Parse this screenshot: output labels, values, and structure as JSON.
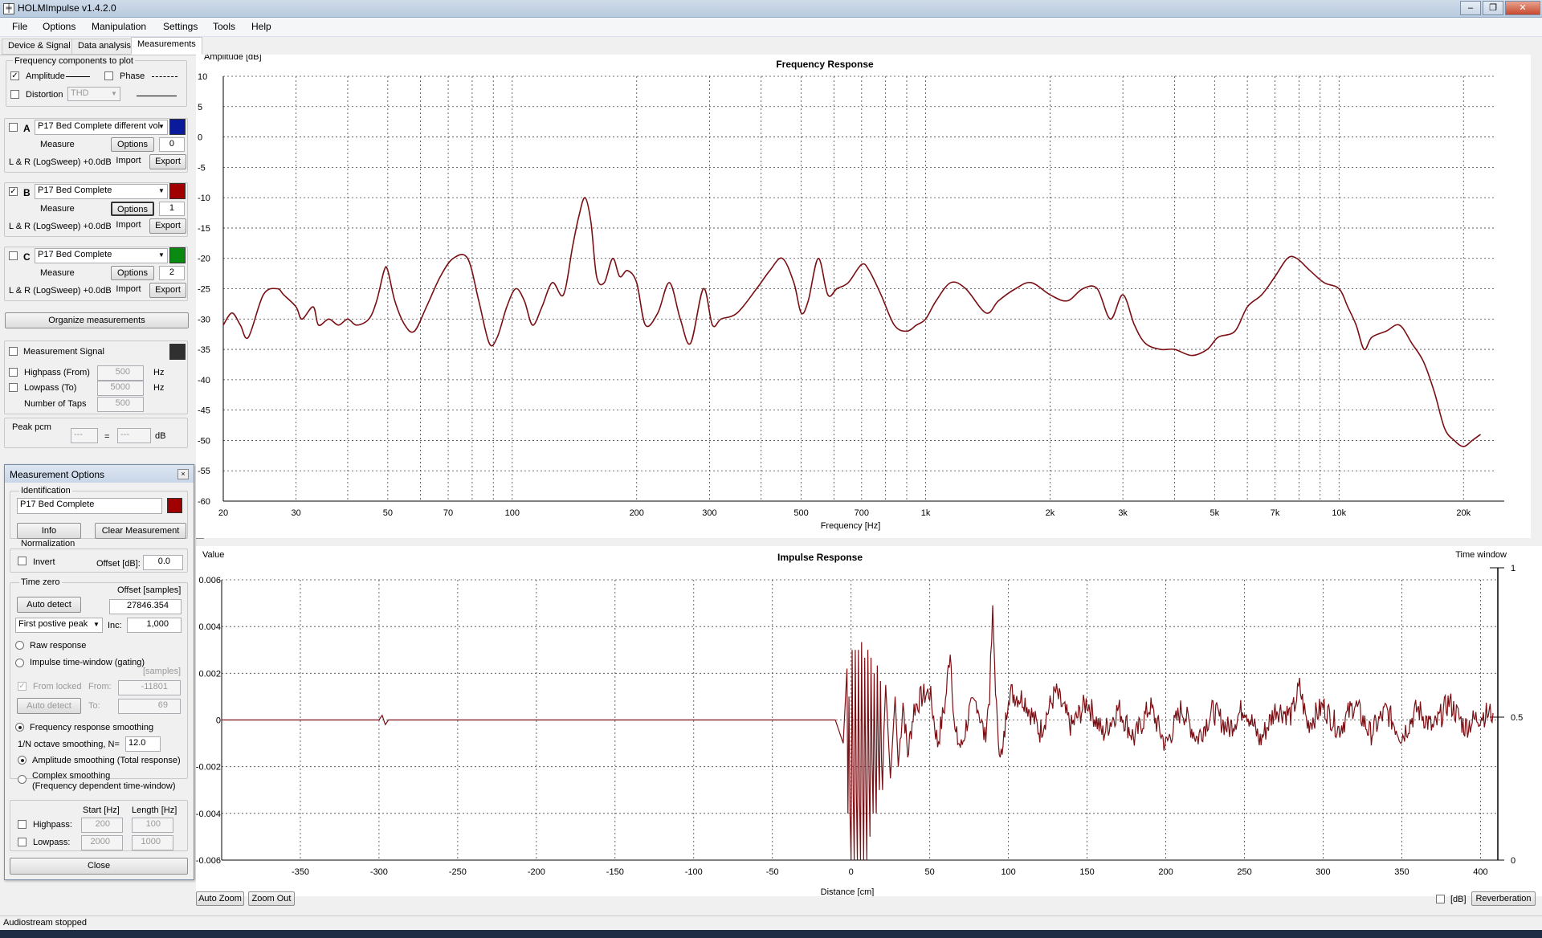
{
  "app": {
    "title": "HOLMImpulse  v1.4.2.0"
  },
  "menu": [
    "File",
    "Options",
    "Manipulation",
    "Settings",
    "Tools",
    "Help"
  ],
  "tabs": [
    "Device & Signal",
    "Data analysis",
    "Measurements"
  ],
  "freqcomp": {
    "title": "Frequency components to plot",
    "amplitude": "Amplitude",
    "phase": "Phase",
    "distortion": "Distortion",
    "distortion_select": "THD"
  },
  "slots": [
    {
      "letter": "A",
      "name": "P17 Bed Complete different vol",
      "color": "#0a1a9a",
      "checked": false,
      "index": "0",
      "info": "L & R (LogSweep) +0.0dB"
    },
    {
      "letter": "B",
      "name": "P17 Bed Complete",
      "color": "#a00000",
      "checked": true,
      "index": "1",
      "info": "L & R (LogSweep) +0.0dB"
    },
    {
      "letter": "C",
      "name": "P17 Bed Complete",
      "color": "#0a8a10",
      "checked": false,
      "index": "2",
      "info": "L & R (LogSweep) +0.0dB"
    }
  ],
  "slot_buttons": {
    "measure": "Measure",
    "options": "Options",
    "import": "Import",
    "export": "Export"
  },
  "organize": "Organize measurements",
  "signal": {
    "label": "Measurement Signal",
    "highpass": "Highpass (From)",
    "highpass_val": "500",
    "lowpass": "Lowpass (To)",
    "lowpass_val": "5000",
    "taps": "Number of Taps",
    "taps_val": "500",
    "hz": "Hz"
  },
  "peak": {
    "label": "Peak pcm",
    "left": "---",
    "eq": "=",
    "right": "---",
    "unit": "dB"
  },
  "mopts": {
    "title": "Measurement Options",
    "identification": "Identification",
    "name": "P17 Bed Complete",
    "color": "#a00000",
    "info_btn": "Info",
    "clear_btn": "Clear Measurement",
    "normalization": "Normalization",
    "invert": "Invert",
    "offset_db": "Offset [dB]:",
    "offset_db_val": "0.0",
    "time_zero": "Time zero",
    "offset_samples": "Offset [samples]",
    "auto_detect": "Auto detect",
    "offset_val": "27846.354",
    "peak_select": "First postive peak",
    "inc": "Inc:",
    "inc_val": "1,000",
    "raw": "Raw response",
    "gating": "Impulse time-window (gating)",
    "samples": "[samples]",
    "from_locked": "From locked",
    "from": "From:",
    "from_val": "-11801",
    "auto_detect2": "Auto detect",
    "to": "To:",
    "to_val": "69",
    "smoothing": "Frequency response smoothing",
    "octave": "1/N octave smoothing, N=",
    "octave_val": "12.0",
    "amp_smooth": "Amplitude smoothing (Total response)",
    "complex1": "Complex smoothing",
    "complex2": "(Frequency dependent time-window)",
    "start_hz": "Start [Hz]",
    "length_hz": "Length [Hz]",
    "highpass": "Highpass:",
    "hp_start": "200",
    "hp_len": "100",
    "lowpass": "Lowpass:",
    "lp_start": "2000",
    "lp_len": "1000",
    "close": "Close"
  },
  "freq_chart": {
    "title": "Frequency Response",
    "ylabel": "Amplitude [dB]",
    "xlabel": "Frequency [Hz]",
    "yticks": [
      "10",
      "5",
      "0",
      "-5",
      "-10",
      "-15",
      "-20",
      "-25",
      "-30",
      "-35",
      "-40",
      "-45",
      "-50",
      "-55",
      "-60"
    ],
    "xticks": [
      "20",
      "30",
      "50",
      "70",
      "100",
      "200",
      "300",
      "500",
      "700",
      "1k",
      "2k",
      "3k",
      "5k",
      "7k",
      "10k",
      "20k"
    ]
  },
  "imp_chart": {
    "title": "Impulse Response",
    "ylabel": "Value",
    "xlabel": "Distance [cm]",
    "right_label": "Time window",
    "yticks": [
      "0.006",
      "0.004",
      "0.002",
      "0",
      "-0.002",
      "-0.004",
      "-0.006"
    ],
    "xticks": [
      "-350",
      "-300",
      "-250",
      "-200",
      "-150",
      "-100",
      "-50",
      "0",
      "50",
      "100",
      "150",
      "200",
      "250",
      "300",
      "350",
      "400"
    ],
    "rticks": [
      "1",
      "0.5",
      "0"
    ]
  },
  "bottom": {
    "auto_zoom": "Auto Zoom",
    "zoom_out": "Zoom Out",
    "db": "[dB]",
    "reverb": "Reverberation"
  },
  "status": "Audiostream stopped",
  "chart_data": [
    {
      "type": "line",
      "title": "Frequency Response",
      "xlabel": "Frequency [Hz]",
      "ylabel": "Amplitude [dB]",
      "xscale": "log",
      "xlim": [
        20,
        24000
      ],
      "ylim": [
        -60,
        10
      ],
      "grid": true,
      "series": [
        {
          "color": "#7a0f14",
          "x": [
            20,
            21,
            22,
            23,
            25,
            27,
            28,
            30,
            31,
            33,
            34,
            36,
            38,
            40,
            42,
            45,
            47,
            49,
            50,
            52,
            55,
            58,
            62,
            67,
            72,
            78,
            83,
            88,
            92,
            97,
            102,
            107,
            112,
            118,
            125,
            133,
            140,
            145,
            150,
            155,
            160,
            167,
            175,
            182,
            190,
            200,
            210,
            225,
            240,
            255,
            270,
            290,
            305,
            320,
            350,
            390,
            420,
            450,
            480,
            500,
            520,
            550,
            580,
            610,
            650,
            700,
            730,
            780,
            840,
            900,
            950,
            1000,
            1060,
            1150,
            1250,
            1400,
            1500,
            1650,
            1800,
            2000,
            2200,
            2400,
            2600,
            2800,
            3000,
            3200,
            3400,
            3700,
            4000,
            4400,
            4800,
            5100,
            5600,
            6000,
            6500,
            7000,
            7500,
            7900,
            8500,
            9200,
            10000,
            10500,
            11000,
            11500,
            12000,
            13000,
            14000,
            15000,
            16000,
            17000,
            18000,
            19000,
            20000,
            21000,
            22000
          ],
          "y": [
            -31,
            -29,
            -31,
            -33,
            -26,
            -25,
            -26,
            -28,
            -30,
            -28,
            -31,
            -30,
            -31,
            -30,
            -31,
            -30,
            -27,
            -22,
            -22,
            -27,
            -31,
            -32,
            -28,
            -23,
            -20,
            -20,
            -27,
            -34,
            -33,
            -28,
            -25,
            -27,
            -31,
            -28,
            -24,
            -26,
            -18,
            -13,
            -10,
            -14,
            -23,
            -24,
            -20,
            -23,
            -22,
            -24,
            -31,
            -29,
            -24,
            -30,
            -34,
            -25,
            -31,
            -30,
            -29,
            -25,
            -22,
            -20,
            -24,
            -29,
            -27,
            -20,
            -26,
            -25,
            -24,
            -21,
            -22,
            -26,
            -31,
            -32,
            -31,
            -30,
            -27,
            -24,
            -25,
            -29,
            -27,
            -25,
            -24,
            -26,
            -27,
            -25,
            -25,
            -30,
            -26,
            -31,
            -34,
            -35,
            -35,
            -36,
            -35,
            -33,
            -32,
            -28,
            -26,
            -23,
            -20,
            -20,
            -22,
            -24,
            -25,
            -28,
            -31,
            -35,
            -33,
            -32,
            -31,
            -34,
            -37,
            -42,
            -48,
            -50,
            -51,
            -50,
            -49
          ]
        }
      ]
    },
    {
      "type": "line",
      "title": "Impulse Response",
      "xlabel": "Distance [cm]",
      "ylabel": "Value",
      "xlim": [
        -400,
        410
      ],
      "ylim": [
        -0.006,
        0.006
      ],
      "grid": true,
      "series": [
        {
          "color": "#7a0f14",
          "x": [
            -400,
            -300,
            -298,
            -296,
            -294,
            -200,
            -100,
            -10,
            -5,
            -2,
            0,
            2,
            4,
            6,
            8,
            10,
            12,
            14,
            16,
            18,
            20,
            22,
            25,
            28,
            30,
            33,
            36,
            40,
            45,
            50,
            55,
            60,
            63,
            66,
            70,
            75,
            80,
            85,
            88,
            90,
            93,
            96,
            100,
            110,
            120,
            130,
            140,
            150,
            160,
            170,
            180,
            190,
            200,
            210,
            220,
            230,
            240,
            250,
            260,
            270,
            280,
            285,
            290,
            300,
            310,
            320,
            330,
            340,
            350,
            360,
            370,
            380,
            390,
            400,
            408
          ],
          "y": [
            0,
            0,
            0.0002,
            -0.0002,
            0,
            0,
            0,
            0,
            -0.001,
            0.003,
            -0.006,
            0.006,
            -0.006,
            0.006,
            -0.005,
            0.005,
            -0.004,
            0.003,
            -0.003,
            0.002,
            -0.002,
            0.0015,
            -0.0025,
            0.001,
            -0.002,
            0.0008,
            -0.0015,
            0.0005,
            0.001,
            0.0012,
            -0.001,
            0.0008,
            0.0031,
            -0.0006,
            -0.0012,
            0.0003,
            0.0008,
            -0.0008,
            0.0011,
            0.0045,
            -0.0005,
            -0.0017,
            0.0012,
            0.0009,
            -0.0005,
            0.0012,
            -0.0003,
            0.0008,
            -0.0006,
            0.0005,
            -0.0008,
            0.0006,
            -0.0011,
            0.0005,
            -0.0008,
            0.0004,
            -0.0004,
            0.0006,
            -0.0009,
            0.0005,
            0.0002,
            0.0014,
            -0.0002,
            0.0006,
            -0.0004,
            0.0007,
            -0.0006,
            0.0004,
            -0.0007,
            0.0005,
            -0.0004,
            0.0008,
            -0.0003,
            0.0002,
            0.0003
          ]
        }
      ]
    }
  ]
}
